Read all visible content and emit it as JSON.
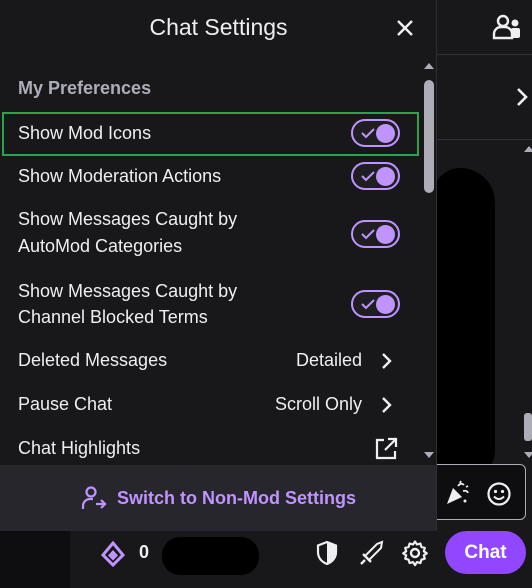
{
  "panel": {
    "title": "Chat Settings",
    "section_heading": "My Preferences",
    "toggles": [
      {
        "label": "Show Mod Icons",
        "on": true
      },
      {
        "label": "Show Moderation Actions",
        "on": true
      },
      {
        "label_line1": "Show Messages Caught by",
        "label_line2": "AutoMod Categories",
        "on": true
      },
      {
        "label_line1": "Show Messages Caught by",
        "label_line2": "Channel Blocked Terms",
        "on": true
      }
    ],
    "nav_rows": [
      {
        "label": "Deleted Messages",
        "value": "Detailed"
      },
      {
        "label": "Pause Chat",
        "value": "Scroll Only"
      },
      {
        "label": "Chat Highlights"
      }
    ],
    "footer_label": "Switch to Non-Mod Settings"
  },
  "bottom_bar": {
    "channel_points": "0",
    "chat_button_label": "Chat"
  },
  "colors": {
    "accent": "#9147ff",
    "accent_light": "#bf94ff",
    "focus_ring": "#2ba24c",
    "panel_bg": "#18181b"
  },
  "icons": [
    "close-icon",
    "checkmark-icon",
    "chevron-right-icon",
    "popout-icon",
    "switch-user-icon",
    "community-icon",
    "cheer-icon",
    "emote-icon",
    "channel-points-icon",
    "mod-shield-icon",
    "sword-icon",
    "settings-gear-icon"
  ]
}
